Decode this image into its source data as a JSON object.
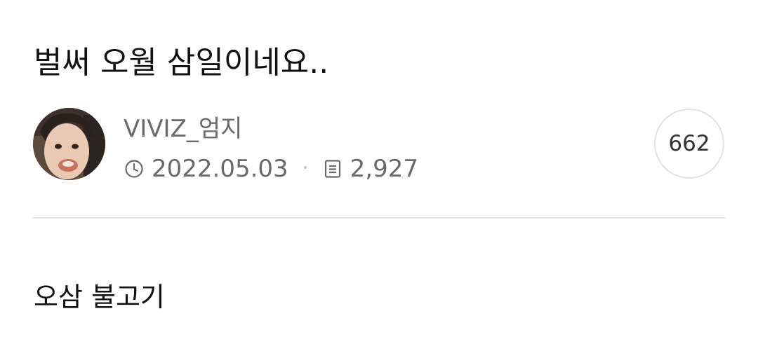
{
  "post": {
    "title": "벌써 오월 삼일이네요..",
    "body": "오삼 불고기"
  },
  "author": {
    "name": "VIVIZ_엄지",
    "avatar": "profile-photo"
  },
  "meta": {
    "date": "2022.05.03",
    "date_icon": "clock-icon",
    "views": "2,927",
    "views_icon": "document-icon"
  },
  "comments": {
    "count": "662"
  },
  "colors": {
    "text_primary": "#111111",
    "text_secondary": "#6a6a6a",
    "divider": "#e6e6e6",
    "badge_border": "#e2e2e2"
  }
}
